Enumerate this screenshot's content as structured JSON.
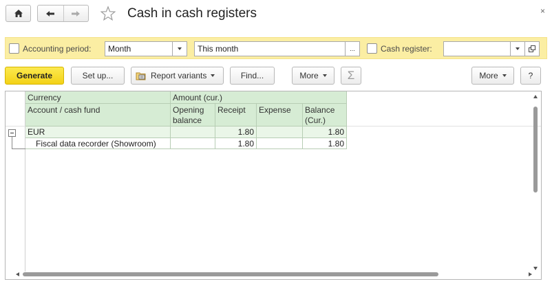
{
  "window": {
    "title": "Cash in cash registers",
    "close_glyph": "×"
  },
  "filters": {
    "accounting_period": {
      "label": "Accounting period:",
      "checked": false,
      "period_type": "Month",
      "period_value": "This month",
      "ellipsis": "..."
    },
    "cash_register": {
      "label": "Cash register:",
      "checked": false,
      "value": ""
    }
  },
  "toolbar": {
    "generate": "Generate",
    "setup": "Set up...",
    "report_variants": "Report variants",
    "find": "Find...",
    "more_left": "More",
    "sum_glyph": "Σ",
    "more_right": "More",
    "help": "?"
  },
  "report": {
    "header": {
      "currency": "Currency",
      "amount_cur": "Amount (cur.)",
      "account_cash_fund": "Account / cash fund",
      "opening_balance": "Opening balance",
      "receipt": "Receipt",
      "expense": "Expense",
      "balance_cur": "Balance (Cur.)"
    },
    "rows": [
      {
        "level": "group",
        "name": "EUR",
        "opening_balance": "",
        "receipt": "1.80",
        "expense": "",
        "balance": "1.80"
      },
      {
        "level": "detail",
        "name": "Fiscal data recorder (Showroom)",
        "opening_balance": "",
        "receipt": "1.80",
        "expense": "",
        "balance": "1.80"
      }
    ]
  },
  "colors": {
    "filter_bar_bg": "#fbeea3",
    "generate_button": "#f3d217",
    "header_green": "#d6ecd4",
    "group_row_green": "#eaf6e8"
  },
  "icons": {
    "home": "home-icon",
    "back": "arrow-left-icon",
    "forward": "arrow-right-icon",
    "favorite": "star-icon",
    "report_variants": "report-variants-icon",
    "collapse": "minus-box-icon",
    "open_form": "open-form-icon"
  }
}
